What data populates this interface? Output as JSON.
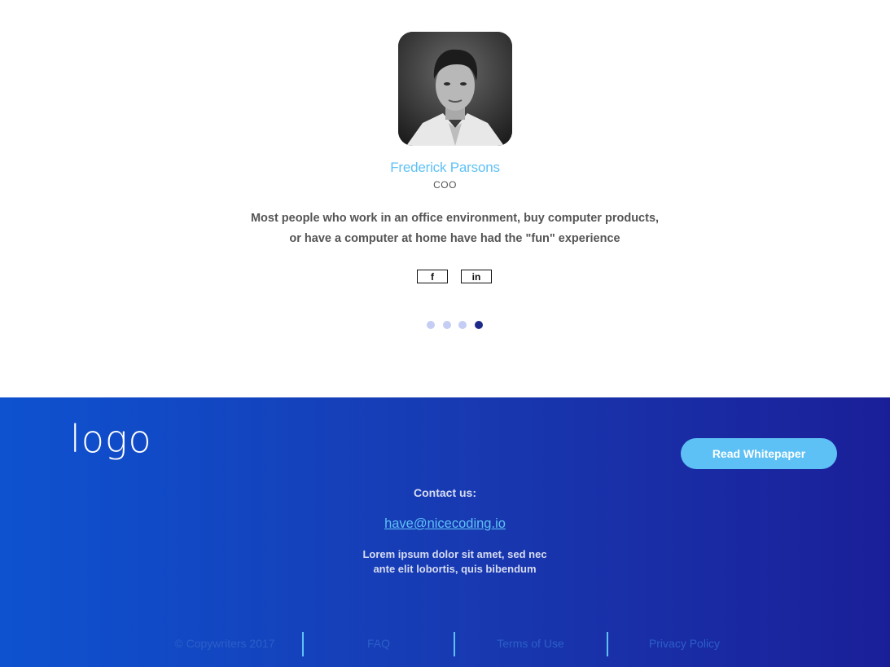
{
  "testimonial": {
    "name": "Frederick Parsons",
    "role": "COO",
    "quote_line1": "Most people who work in an office environment, buy computer products,",
    "quote_line2": "or have a computer at home have had the \"fun\" experience",
    "social": [
      {
        "icon": "facebook-icon",
        "glyph": "f"
      },
      {
        "icon": "linkedin-icon",
        "glyph": "in"
      }
    ],
    "carousel": {
      "total": 4,
      "active_index": 3
    }
  },
  "footer": {
    "logo": "logo",
    "cta_label": "Read Whitepaper",
    "contact_label": "Contact us:",
    "email": "have@nicecoding.io",
    "blurb_line1": "Lorem ipsum dolor sit amet, sed nec",
    "blurb_line2": "ante elit lobortis, quis bibendum",
    "links": [
      "© Copywriters 2017",
      "FAQ",
      "Terms of Use",
      "Privacy Policy"
    ]
  },
  "colors": {
    "accent": "#5ec1f5",
    "footer_gradient_start": "#0e52d0",
    "footer_gradient_end": "#1a1f98",
    "dot_active": "#1e2a8a",
    "dot_inactive": "#c4cdf3"
  }
}
